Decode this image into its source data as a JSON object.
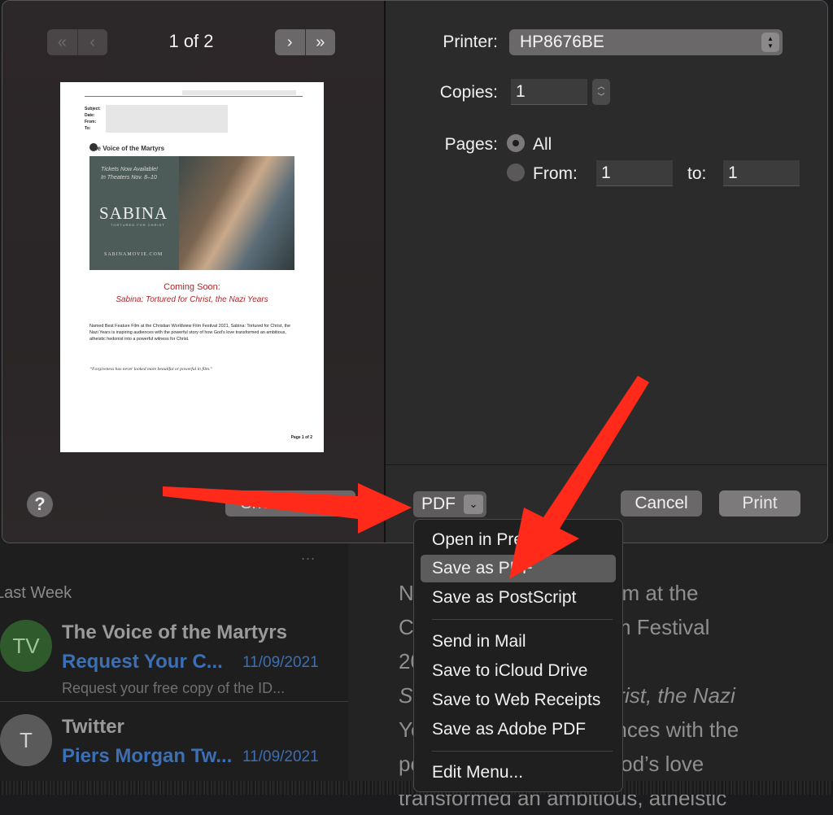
{
  "print_dialog": {
    "page_counter": "1 of 2",
    "nav": {
      "first_icon": "chevron-double-left-icon",
      "prev_icon": "chevron-left-icon",
      "next_icon": "chevron-right-icon",
      "last_icon": "chevron-double-right-icon"
    },
    "printer_label": "Printer:",
    "printer_value": "HP8676BE",
    "copies_label": "Copies:",
    "copies_value": "1",
    "pages_label": "Pages:",
    "pages_all_label": "All",
    "pages_from_label": "From:",
    "pages_from_value": "1",
    "pages_to_label": "to:",
    "pages_to_value": "1",
    "help_label": "?",
    "show_details_label": "Show Details",
    "pdf_label": "PDF",
    "cancel_label": "Cancel",
    "print_label": "Print"
  },
  "preview_page": {
    "header_fields": [
      "Subject:",
      "Date:",
      "From:",
      "To:"
    ],
    "logo_text": "the Voice of the Martyrs",
    "banner_tickets": "Tickets Now Available!",
    "banner_theaters": "In Theaters Nov. 8–10",
    "banner_title": "SABINA",
    "banner_sub": "TORTURED FOR CHRIST",
    "banner_url": "SABINAMOVIE.COM",
    "coming_soon": "Coming Soon:",
    "coming_title": "Sabina: Tortured for Christ, the Nazi Years",
    "body_text": "Named Best Feature Film at the Christian Worldview Film Festival 2021, Sabina: Tortured for Christ, the Nazi Years is inspiring audiences with the powerful story of how God's love transformed an ambitious, atheistic hedonist into a powerful witness for Christ.",
    "quote": "“Forgiveness has never looked more beautiful or powerful in film.”",
    "footer": "Page 1 of 2"
  },
  "pdf_menu": {
    "items": [
      "Open in Preview",
      "Save as PDF",
      "Save as PostScript",
      "Send in Mail",
      "Save to iCloud Drive",
      "Save to Web Receipts",
      "Save as Adobe PDF",
      "Edit Menu..."
    ],
    "highlighted": "Save as PDF"
  },
  "mail_list": {
    "ellipsis": "...",
    "section_header": "Last Week",
    "messages": [
      {
        "initials": "TV",
        "sender": "The Voice of the Martyrs",
        "subject": "Request Your C...",
        "date": "11/09/2021",
        "preview": "Request your free copy of the ID..."
      },
      {
        "initials": "T",
        "sender": "Twitter",
        "subject": "Piers Morgan Tw...",
        "date": "11/09/2021",
        "preview": ""
      }
    ]
  },
  "reader": {
    "lines": [
      "Named Best Feature Film at the",
      "Christian Worldview Film Festival 2021,",
      "Sabina: Tortured for Christ, the Nazi",
      "Years is inspiring audiences with the",
      "powerful story of how God’s love",
      "transformed an ambitious, atheistic"
    ]
  },
  "colors": {
    "annotation_red": "#ff2a1a",
    "link_blue": "#3c6fb4",
    "highlight": "#5c5c5c"
  }
}
